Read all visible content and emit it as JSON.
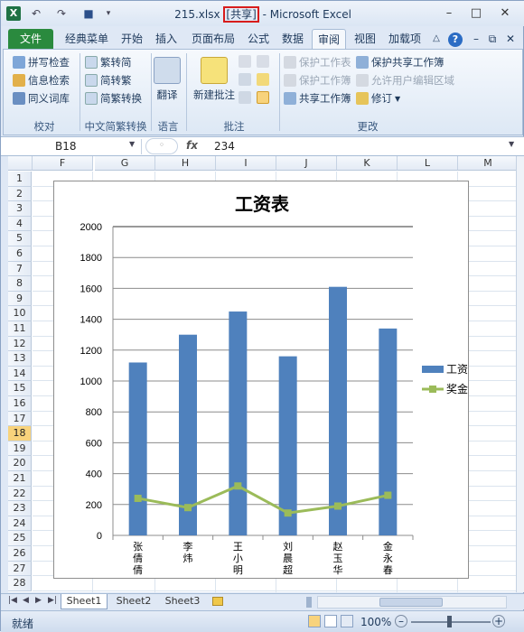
{
  "app": {
    "title_pre": "215.xlsx ",
    "title_shared": "[共享]",
    "title_post": " - Microsoft Excel"
  },
  "tabs": [
    "文件",
    "经典菜单",
    "开始",
    "插入",
    "页面布局",
    "公式",
    "数据",
    "审阅",
    "视图",
    "加载项"
  ],
  "ribbon": {
    "proofing": {
      "items": [
        "拼写检查",
        "信息检索",
        "同义词库"
      ],
      "group": "校对"
    },
    "chinese": {
      "items": [
        "繁转简",
        "简转繁",
        "简繁转换"
      ],
      "group": "中文简繁转换"
    },
    "language": {
      "button": "翻译",
      "group": "语言"
    },
    "comments": {
      "button": "新建批注",
      "group": "批注"
    },
    "changes": {
      "left": [
        "保护工作表",
        "保护工作簿",
        "共享工作簿"
      ],
      "right": [
        "保护共享工作簿",
        "允许用户编辑区域",
        "修订"
      ],
      "group": "更改"
    }
  },
  "formula_bar": {
    "name_box": "B18",
    "fx": "fx",
    "value": "234"
  },
  "columns": [
    "F",
    "G",
    "H",
    "I",
    "J",
    "K",
    "L",
    "M"
  ],
  "rows": [
    "1",
    "2",
    "3",
    "4",
    "5",
    "6",
    "7",
    "8",
    "9",
    "10",
    "11",
    "12",
    "13",
    "14",
    "15",
    "16",
    "17",
    "18",
    "19",
    "20",
    "21",
    "22",
    "23",
    "24",
    "25",
    "26",
    "27",
    "28"
  ],
  "selected_row": "18",
  "sheets": [
    "Sheet1",
    "Sheet2",
    "Sheet3"
  ],
  "status": {
    "ready": "就绪",
    "zoom": "100%"
  },
  "chart_data": {
    "type": "bar",
    "title": "工资表",
    "categories": [
      "张倩倩",
      "李炜",
      "王小明",
      "刘晨超",
      "赵玉华",
      "金永春"
    ],
    "series": [
      {
        "name": "工资",
        "kind": "bar",
        "color": "#4f81bd",
        "values": [
          1120,
          1300,
          1450,
          1160,
          1610,
          1340
        ]
      },
      {
        "name": "奖金",
        "kind": "line",
        "color": "#9bbb59",
        "values": [
          240,
          180,
          320,
          145,
          190,
          260
        ]
      }
    ],
    "ylim": [
      0,
      2000
    ],
    "yticks": [
      "0",
      "200",
      "400",
      "600",
      "800",
      "1000",
      "1200",
      "1400",
      "1600",
      "1800",
      "2000"
    ],
    "legend": "right",
    "grid": true
  }
}
